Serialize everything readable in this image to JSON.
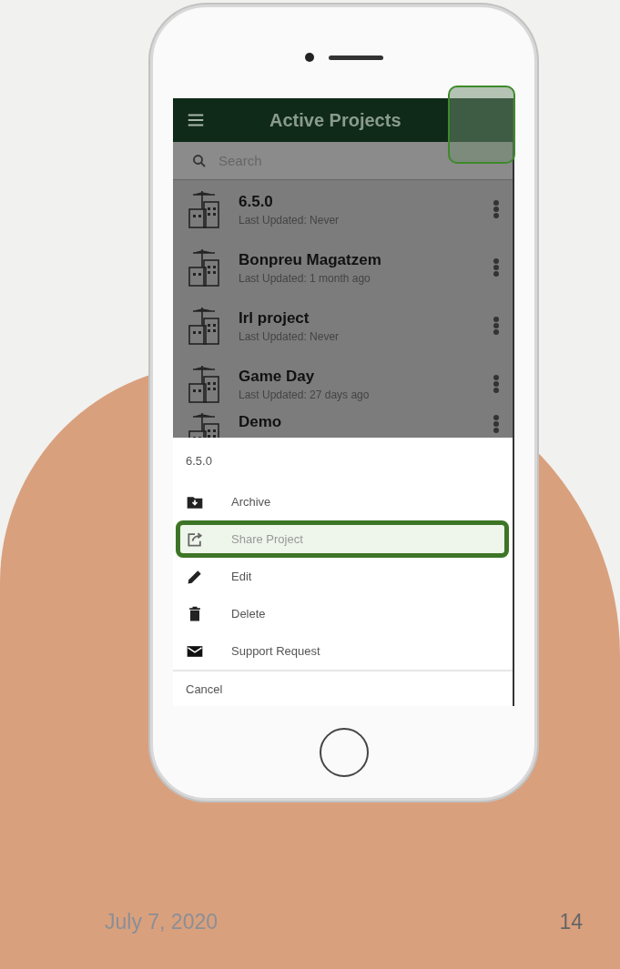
{
  "app": {
    "title": "Active Projects",
    "search": {
      "placeholder": "Search"
    },
    "projects": [
      {
        "name": "6.5.0",
        "updated": "Last Updated: Never"
      },
      {
        "name": "Bonpreu Magatzem",
        "updated": "Last Updated: 1 month ago"
      },
      {
        "name": "Irl project",
        "updated": "Last Updated: Never"
      },
      {
        "name": "Game Day",
        "updated": "Last Updated: 27 days ago"
      },
      {
        "name": "Demo"
      }
    ],
    "action_sheet": {
      "title": "6.5.0",
      "items": [
        {
          "kind": "archive",
          "label": "Archive",
          "highlighted": false
        },
        {
          "kind": "share",
          "label": "Share Project",
          "highlighted": true
        },
        {
          "kind": "edit",
          "label": "Edit",
          "highlighted": false
        },
        {
          "kind": "delete",
          "label": "Delete",
          "highlighted": false
        },
        {
          "kind": "mail",
          "label": "Support Request",
          "highlighted": false
        }
      ],
      "cancel": "Cancel"
    }
  },
  "footer": {
    "date": "July 7, 2020",
    "page": "14"
  }
}
